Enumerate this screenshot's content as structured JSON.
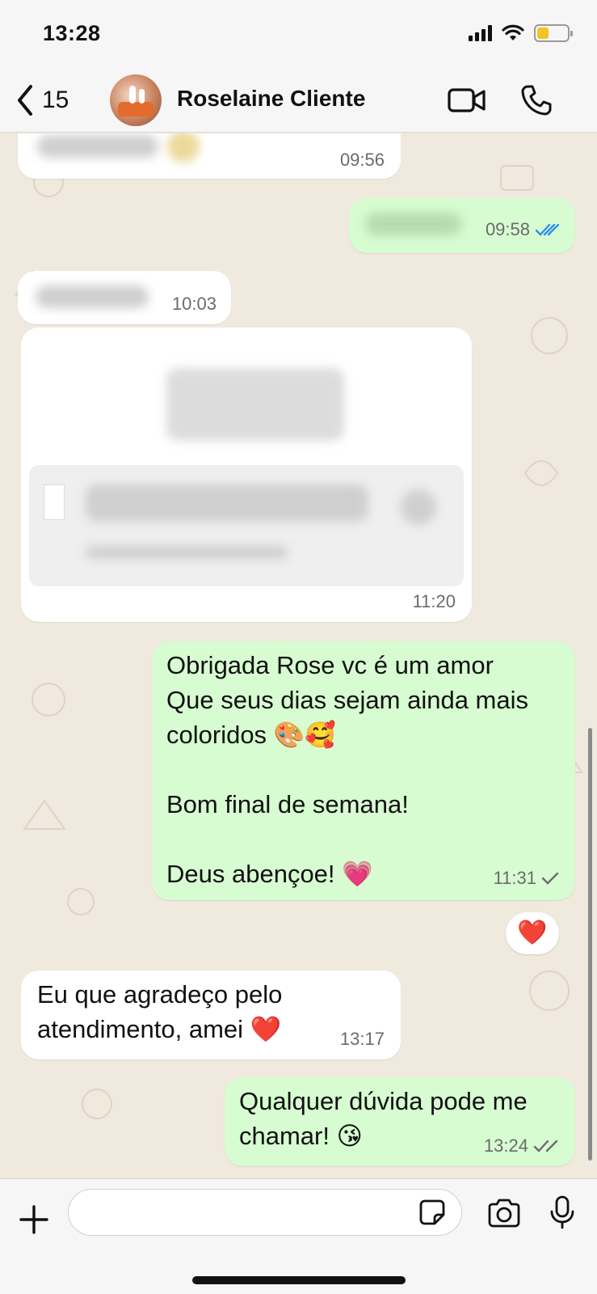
{
  "status_bar": {
    "time": "13:28"
  },
  "header": {
    "back_count": "15",
    "contact_name": "Roselaine Cliente"
  },
  "messages": [
    {
      "direction": "incoming",
      "text": "",
      "time": "09:56",
      "blurred": true
    },
    {
      "direction": "outgoing",
      "text": "",
      "time": "09:58",
      "status": "read",
      "blurred": true
    },
    {
      "direction": "incoming",
      "text": "",
      "time": "10:03",
      "blurred": true
    },
    {
      "direction": "incoming",
      "type": "document",
      "text": "",
      "time": "11:20",
      "blurred": true
    },
    {
      "direction": "outgoing",
      "text": "Obrigada Rose vc é um amor\nQue seus dias sejam ainda mais\ncoloridos 🎨🥰\n\nBom final de semana!\n\nDeus abençoe! 💗",
      "time": "11:31",
      "status": "delivered",
      "reaction": "❤️"
    },
    {
      "direction": "incoming",
      "text": "Eu que agradeço pelo\natendimento, amei ❤️",
      "time": "13:17"
    },
    {
      "direction": "outgoing",
      "text": "Qualquer dúvida pode me\nchamar! 😘",
      "time": "13:24",
      "status": "delivered"
    }
  ],
  "composer": {
    "placeholder": ""
  },
  "colors": {
    "incoming_bubble": "#ffffff",
    "outgoing_bubble": "#d7fcd1",
    "read_ticks": "#2f8ef0",
    "chat_background": "#efe9de"
  }
}
